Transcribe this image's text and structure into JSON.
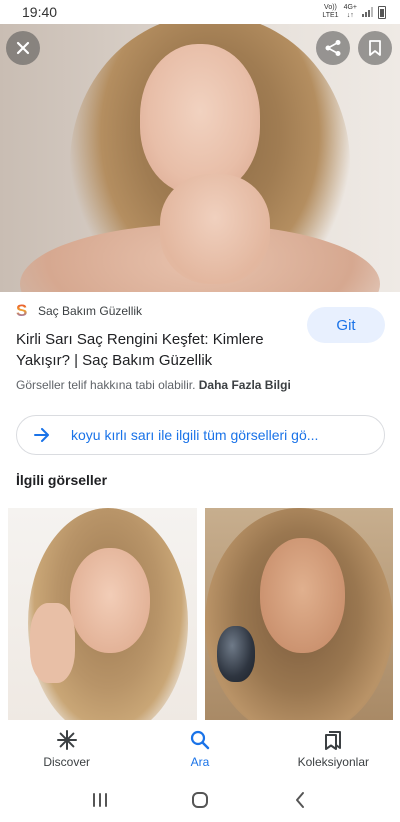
{
  "status_bar": {
    "time": "19:40",
    "carrier_top": "Vo))",
    "carrier_bottom": "LTE1",
    "network_top": "4G+",
    "network_bottom": "↓↑"
  },
  "hero": {
    "image_alt": "woman with wavy dark blonde hair",
    "close_icon": "close-icon",
    "share_icon": "share-icon",
    "save_icon": "bookmark-icon"
  },
  "result": {
    "source_logo": "S",
    "source_name": "Saç Bakım Güzellik",
    "title": "Kirli Sarı Saç Rengini Keşfet: Kimlere Yakışır? | Saç Bakım Güzellik",
    "visit_label": "Git",
    "copyright_text": "Görseller telif hakkına tabi olabilir.",
    "more_info": "Daha Fazla Bilgi"
  },
  "all_images": {
    "label": "koyu kırlı sarı ile ilgili tüm görselleri gö..."
  },
  "related": {
    "heading": "İlgili görseller"
  },
  "bottom_nav": {
    "items": [
      {
        "label": "Discover",
        "icon": "asterisk-icon"
      },
      {
        "label": "Ara",
        "icon": "search-icon"
      },
      {
        "label": "Koleksiyonlar",
        "icon": "collections-icon"
      }
    ]
  },
  "colors": {
    "accent": "#1a73e8",
    "visit_bg": "#e8f0fe"
  }
}
